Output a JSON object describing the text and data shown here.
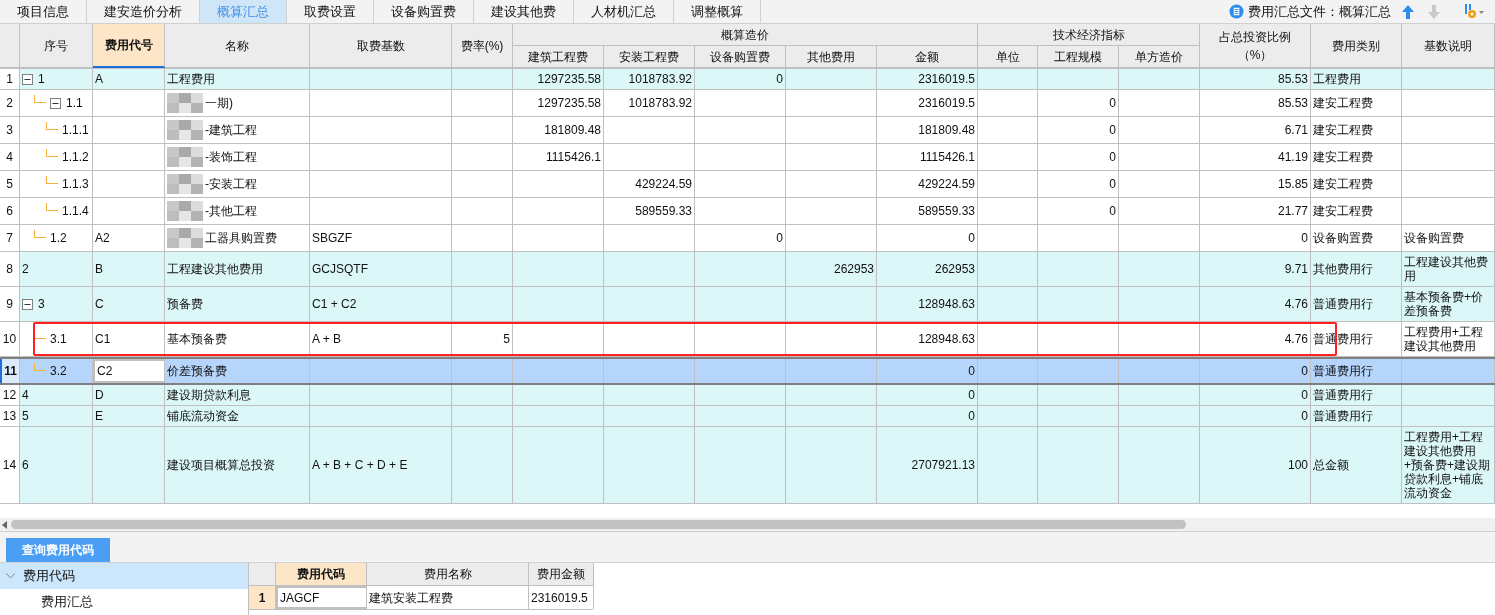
{
  "tabs": [
    {
      "label": "项目信息",
      "selected": false
    },
    {
      "label": "建安造价分析",
      "selected": false
    },
    {
      "label": "概算汇总",
      "selected": true
    },
    {
      "label": "取费设置",
      "selected": false
    },
    {
      "label": "设备购置费",
      "selected": false
    },
    {
      "label": "建设其他费",
      "selected": false
    },
    {
      "label": "人材机汇总",
      "selected": false
    },
    {
      "label": "调整概算",
      "selected": false
    }
  ],
  "toolbar": {
    "file_label": "费用汇总文件：概算汇总",
    "move_up_disabled": false,
    "move_down_disabled": true
  },
  "table": {
    "column_groups": [
      "概算造价",
      "技术经济指标"
    ],
    "columns": [
      {
        "label": "序号",
        "selected": false
      },
      {
        "label": "费用代号",
        "selected": true
      },
      {
        "label": "名称",
        "selected": false
      },
      {
        "label": "取费基数",
        "selected": false
      },
      {
        "label": "费率(%)",
        "selected": false
      },
      {
        "label": "建筑工程费",
        "selected": false
      },
      {
        "label": "安装工程费",
        "selected": false
      },
      {
        "label": "设备购置费",
        "selected": false
      },
      {
        "label": "其他费用",
        "selected": false
      },
      {
        "label": "金额",
        "selected": false
      },
      {
        "label": "单位",
        "selected": false
      },
      {
        "label": "工程规模",
        "selected": false
      },
      {
        "label": "单方造价",
        "selected": false
      },
      {
        "label": "占总投资比例（%）",
        "selected": false
      },
      {
        "label": "费用类别",
        "selected": false
      },
      {
        "label": "基数说明",
        "selected": false
      }
    ],
    "rows": [
      {
        "row_number": "1",
        "expanded": true,
        "selected": false,
        "highlighted": true,
        "outlined": false,
        "blurred": false,
        "cells": [
          "1",
          "A",
          "工程费用",
          null,
          null,
          "1297235.58",
          "1018783.92",
          "0",
          null,
          "2316019.5",
          null,
          null,
          null,
          "85.53",
          "工程费用",
          null
        ],
        "children": [
          {
            "row_number": "2",
            "expanded": true,
            "selected": false,
            "highlighted": false,
            "outlined": false,
            "blurred": true,
            "cells": [
              "1.1",
              null,
              "一期)",
              null,
              null,
              "1297235.58",
              "1018783.92",
              null,
              null,
              "2316019.5",
              null,
              "0",
              null,
              "85.53",
              "建安工程费",
              null
            ],
            "children": [
              {
                "row_number": "3",
                "selected": false,
                "highlighted": false,
                "outlined": false,
                "blurred": true,
                "cells": [
                  "1.1.1",
                  null,
                  "-建筑工程",
                  null,
                  null,
                  "181809.48",
                  null,
                  null,
                  null,
                  "181809.48",
                  null,
                  "0",
                  null,
                  "6.71",
                  "建安工程费",
                  null
                ]
              },
              {
                "row_number": "4",
                "selected": false,
                "highlighted": false,
                "outlined": false,
                "blurred": true,
                "cells": [
                  "1.1.2",
                  null,
                  "-装饰工程",
                  null,
                  null,
                  "1115426.1",
                  null,
                  null,
                  null,
                  "1115426.1",
                  null,
                  "0",
                  null,
                  "41.19",
                  "建安工程费",
                  null
                ]
              },
              {
                "row_number": "5",
                "selected": false,
                "highlighted": false,
                "outlined": false,
                "blurred": true,
                "cells": [
                  "1.1.3",
                  null,
                  "-安装工程",
                  null,
                  null,
                  null,
                  "429224.59",
                  null,
                  null,
                  "429224.59",
                  null,
                  "0",
                  null,
                  "15.85",
                  "建安工程费",
                  null
                ]
              },
              {
                "row_number": "6",
                "selected": false,
                "highlighted": false,
                "outlined": false,
                "blurred": true,
                "cells": [
                  "1.1.4",
                  null,
                  "-其他工程",
                  null,
                  null,
                  null,
                  "589559.33",
                  null,
                  null,
                  "589559.33",
                  null,
                  "0",
                  null,
                  "21.77",
                  "建安工程费",
                  null
                ]
              }
            ]
          },
          {
            "row_number": "7",
            "selected": false,
            "highlighted": false,
            "outlined": false,
            "blurred": true,
            "cells": [
              "1.2",
              "A2",
              "工器具购置费",
              "SBGZF",
              null,
              null,
              null,
              "0",
              null,
              "0",
              null,
              null,
              null,
              "0",
              "设备购置费",
              "设备购置费"
            ]
          }
        ]
      },
      {
        "row_number": "8",
        "selected": false,
        "highlighted": true,
        "outlined": false,
        "blurred": false,
        "cells": [
          "2",
          "B",
          "工程建设其他费用",
          "GCJSQTF",
          null,
          null,
          null,
          null,
          "262953",
          "262953",
          null,
          null,
          null,
          "9.71",
          "其他费用行",
          "工程建设其他费用"
        ]
      },
      {
        "row_number": "9",
        "expanded": true,
        "selected": false,
        "highlighted": true,
        "outlined": false,
        "blurred": false,
        "cells": [
          "3",
          "C",
          "预备费",
          "C1 + C2",
          null,
          null,
          null,
          null,
          null,
          "128948.63",
          null,
          null,
          null,
          "4.76",
          "普通费用行",
          "基本预备费+价差预备费"
        ],
        "children": [
          {
            "row_number": "10",
            "selected": false,
            "highlighted": false,
            "outlined": true,
            "blurred": false,
            "cells": [
              "3.1",
              "C1",
              "基本预备费",
              "A + B",
              "5",
              null,
              null,
              null,
              null,
              "128948.63",
              null,
              null,
              null,
              "4.76",
              "普通费用行",
              "工程费用+工程建设其他费用"
            ]
          },
          {
            "row_number": "11",
            "selected": true,
            "highlighted": false,
            "outlined": false,
            "blurred": false,
            "cells": [
              "3.2",
              "C2",
              "价差预备费",
              null,
              null,
              null,
              null,
              null,
              null,
              "0",
              null,
              null,
              null,
              "0",
              "普通费用行",
              null
            ]
          }
        ]
      },
      {
        "row_number": "12",
        "selected": false,
        "highlighted": true,
        "outlined": false,
        "blurred": false,
        "cells": [
          "4",
          "D",
          "建设期贷款利息",
          null,
          null,
          null,
          null,
          null,
          null,
          "0",
          null,
          null,
          null,
          "0",
          "普通费用行",
          null
        ]
      },
      {
        "row_number": "13",
        "selected": false,
        "highlighted": true,
        "outlined": false,
        "blurred": false,
        "cells": [
          "5",
          "E",
          "铺底流动资金",
          null,
          null,
          null,
          null,
          null,
          null,
          "0",
          null,
          null,
          null,
          "0",
          "普通费用行",
          null
        ]
      },
      {
        "row_number": "14",
        "selected": false,
        "highlighted": true,
        "outlined": false,
        "blurred": false,
        "cells": [
          "6",
          null,
          "建设项目概算总投资",
          "A + B + C + D + E",
          null,
          null,
          null,
          null,
          null,
          "2707921.13",
          null,
          null,
          null,
          "100",
          "总金额",
          "工程费用+工程建设其他费用+预备费+建设期贷款利息+铺底流动资金"
        ]
      }
    ]
  },
  "bottom_panel": {
    "tab": {
      "label": "查询费用代码",
      "selected": true
    },
    "tree": [
      {
        "label": "费用代码",
        "expanded": true,
        "selected": true,
        "children": [
          {
            "label": "费用汇总",
            "selected": false
          }
        ]
      }
    ],
    "code_table": {
      "columns": [
        {
          "label": "费用代码",
          "selected": true
        },
        {
          "label": "费用名称",
          "selected": false
        },
        {
          "label": "费用金额",
          "selected": false
        }
      ],
      "rows": [
        {
          "row_number": "1",
          "selected": true,
          "cells": [
            "JAGCF",
            "建筑安装工程费",
            "2316019.5"
          ]
        }
      ]
    }
  }
}
